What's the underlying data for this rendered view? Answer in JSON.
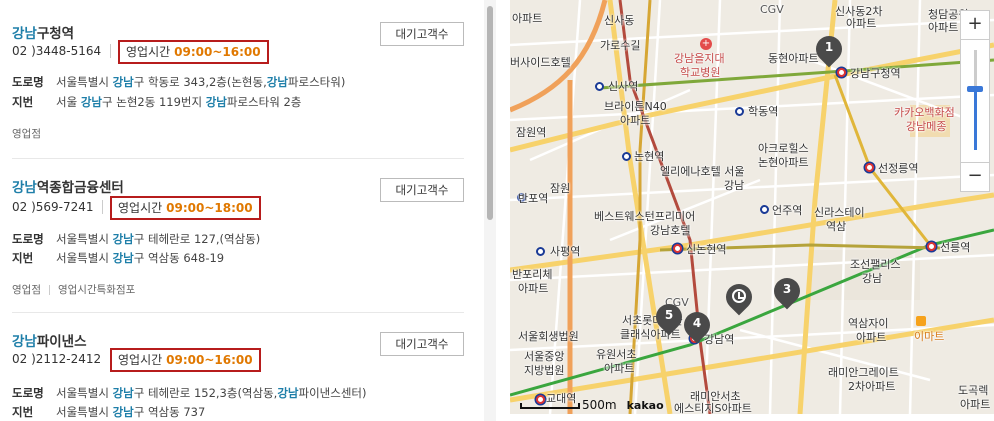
{
  "branches": [
    {
      "name_hl": "강남",
      "name_rest": "구청역",
      "phone": "02 )3448-5164",
      "hours_label": "영업시간",
      "hours_value": "09:00~16:00",
      "wait_label": "대기고객수",
      "road_key": "도로명",
      "road_pre": "서울특별시 ",
      "road_hl1": "강남",
      "road_mid": "구 학동로 343,2층(논현동,",
      "road_hl2": "강남",
      "road_post": "파로스타워)",
      "lot_key": "지번",
      "lot_pre": "서울 ",
      "lot_hl1": "강남",
      "lot_mid": "구 논현2동 119번지 ",
      "lot_hl2": "강남",
      "lot_post": "파로스타워 2층",
      "tags": [
        "영업점"
      ]
    },
    {
      "name_hl": "강남",
      "name_rest": "역종합금융센터",
      "phone": "02 )569-7241",
      "hours_label": "영업시간",
      "hours_value": "09:00~18:00",
      "wait_label": "대기고객수",
      "road_key": "도로명",
      "road_pre": "서울특별시 ",
      "road_hl1": "강남",
      "road_mid": "구 테헤란로 127,(역삼동)",
      "road_hl2": "",
      "road_post": "",
      "lot_key": "지번",
      "lot_pre": "서울특별시 ",
      "lot_hl1": "강남",
      "lot_mid": "구 역삼동 648-19",
      "lot_hl2": "",
      "lot_post": "",
      "tags": [
        "영업점",
        "영업시간특화점포"
      ]
    },
    {
      "name_hl": "강남",
      "name_rest": "파이낸스",
      "phone": "02 )2112-2412",
      "hours_label": "영업시간",
      "hours_value": "09:00~16:00",
      "wait_label": "대기고객수",
      "road_key": "도로명",
      "road_pre": "서울특별시 ",
      "road_hl1": "강남",
      "road_mid": "구 테헤란로 152,3층(역삼동,",
      "road_hl2": "강남",
      "road_post": "파이낸스센터)",
      "lot_key": "지번",
      "lot_pre": "서울특별시 ",
      "lot_hl1": "강남",
      "lot_mid": "구 역삼동 737",
      "lot_hl2": "",
      "lot_post": "",
      "tags": []
    }
  ],
  "map": {
    "labels": {
      "apt_top1": "아파트",
      "sinsa_dong": "신사동",
      "garosugil": "가로수길",
      "cgv": "CGV",
      "apt_top2": "아파트",
      "sinsa_dong2": "신사동2차",
      "apt_top3": "아파트",
      "cheongdam1": "청담공원",
      "cheongdam2": "아파트",
      "hospital1": "강남을지대",
      "hospital2": "학교병원",
      "dongheon": "동현아파트",
      "ibis1": "버사이드호텔",
      "sinsa": "신사역",
      "gangnamgu": "강남구청역",
      "brighton1": "브라이튼N40",
      "brighton2": "아파트",
      "hakdong": "학동역",
      "jamwon": "잠원역",
      "kakao1": "카카오백화점",
      "kakao2": "강남메종",
      "nonhyeon": "논현역",
      "acro1": "아크로힐스",
      "acro2": "논현아파트",
      "seonjeongneung": "선정릉역",
      "eliena1": "엘리에나호텔 서울",
      "eliena2": "강남",
      "jamwon2": "잠원",
      "banpo": "반포역",
      "bestwestern1": "베스트웨스턴프리미어",
      "bestwestern2": "강남호텔",
      "eonju": "언주역",
      "shilla1": "신라스테이",
      "shilla2": "역삼",
      "sapyeong": "사평역",
      "sinnonhyeon": "신논현역",
      "seolleung": "선릉역",
      "banpo_apt1": "반포리체",
      "banpo_apt2": "아파트",
      "chosun1": "조선팰리스",
      "chosun2": "강남",
      "cgv2": "CGV",
      "lotte1": "서초롯데캐슬",
      "lotte2": "클래식아파트",
      "seoulhoe": "서울회생법원",
      "seoulchung1": "서울중앙",
      "seoulchung2": "지방법원",
      "yuwon1": "유원서초",
      "yuwon2": "아파트",
      "gangnam": "강남역",
      "yeoksamja1": "역삼자이",
      "yeoksamja2": "아파트",
      "emart": "이마트",
      "gyodae": "교대역",
      "lamian1": "래미안서초",
      "lamian2": "에스티지S아파트",
      "raemian1": "래미안그레이트",
      "raemian2": "2차아파트",
      "dogok1": "도곡렉",
      "dogok2": "아파트",
      "scale": "500m",
      "logo": "kakao"
    },
    "markers": [
      "1",
      "3",
      "4",
      "5"
    ],
    "zoom_in": "+",
    "zoom_out": "−",
    "zoom_level": 0.62,
    "icons": [
      "clock-icon",
      "hospital-icon",
      "mart-icon"
    ]
  }
}
